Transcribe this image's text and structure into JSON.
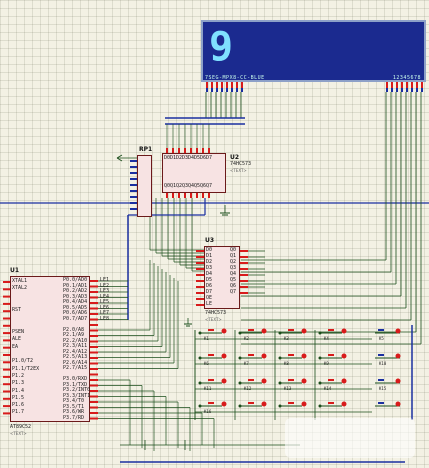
{
  "display": {
    "digit": "9",
    "left_label": "7SEG-MPX8-CC-BLUE",
    "right_label": "12345678"
  },
  "rp1": {
    "ref": "RP1",
    "value": "RESPACK-8"
  },
  "u2": {
    "ref": "U2",
    "part": "74HC573",
    "sub": "<TEXT>"
  },
  "u3": {
    "ref": "U3",
    "part": "74HC573",
    "sub": "<TEXT>"
  },
  "u1": {
    "ref": "U1",
    "part": "AT89C52",
    "sub": "<TEXT>"
  },
  "pins": {
    "u1_left": [
      "XTAL1",
      "XTAL2",
      "",
      "",
      "RST",
      "",
      "",
      "PSEN",
      "ALE",
      "EA",
      "",
      "P1.0/T2",
      "P1.1/T2EX",
      "P1.2",
      "P1.3",
      "P1.4",
      "P1.5",
      "P1.6",
      "P1.7"
    ],
    "u1_right": [
      "P0.0/AD0",
      "P0.1/AD1",
      "P0.2/AD2",
      "P0.3/AD3",
      "P0.4/AD4",
      "P0.5/AD5",
      "P0.6/AD6",
      "P0.7/AD7",
      "",
      "P2.0/A8",
      "P2.1/A9",
      "P2.2/A10",
      "P2.3/A11",
      "P2.4/A12",
      "P2.5/A13",
      "P2.6/A14",
      "P2.7/A15",
      "",
      "P3.0/RXD",
      "P3.1/TXD",
      "P3.2/INT0",
      "P3.3/INT1",
      "P3.4/T0",
      "P3.5/T1",
      "P3.6/WR",
      "P3.7/RD"
    ],
    "u3_left": [
      "D0",
      "D1",
      "D2",
      "D3",
      "D4",
      "D5",
      "D6",
      "D7",
      "OE",
      "LE"
    ],
    "u3_right": [
      "Q0",
      "Q1",
      "Q2",
      "Q3",
      "Q4",
      "Q5",
      "Q6",
      "Q7"
    ],
    "u2_top": [
      "D0",
      "D1",
      "D2",
      "D3",
      "D4",
      "D5",
      "D6",
      "D7"
    ],
    "u2_bottom": [
      "Q0",
      "Q1",
      "Q2",
      "Q3",
      "Q4",
      "Q5",
      "Q6",
      "Q7"
    ],
    "net_labels": [
      "LE1",
      "LE2",
      "LE3",
      "LE4",
      "LE5",
      "LE6",
      "LE7",
      "LE8"
    ]
  },
  "keys": [
    "K1",
    "K2",
    "K3",
    "K4",
    "K5",
    "K6",
    "K7",
    "K8",
    "K9",
    "K10",
    "K11",
    "K12",
    "K13",
    "K14",
    "K15",
    "K16"
  ],
  "colors": {
    "wire": "#1a4d1a",
    "bus": "#1a2fa0",
    "chip_border": "#6b1a1a",
    "chip_fill": "#f7e3e3",
    "display_bg": "#1b2a8f",
    "pin_red": "#d81b1b",
    "pin_blue": "#1a2fa0"
  }
}
